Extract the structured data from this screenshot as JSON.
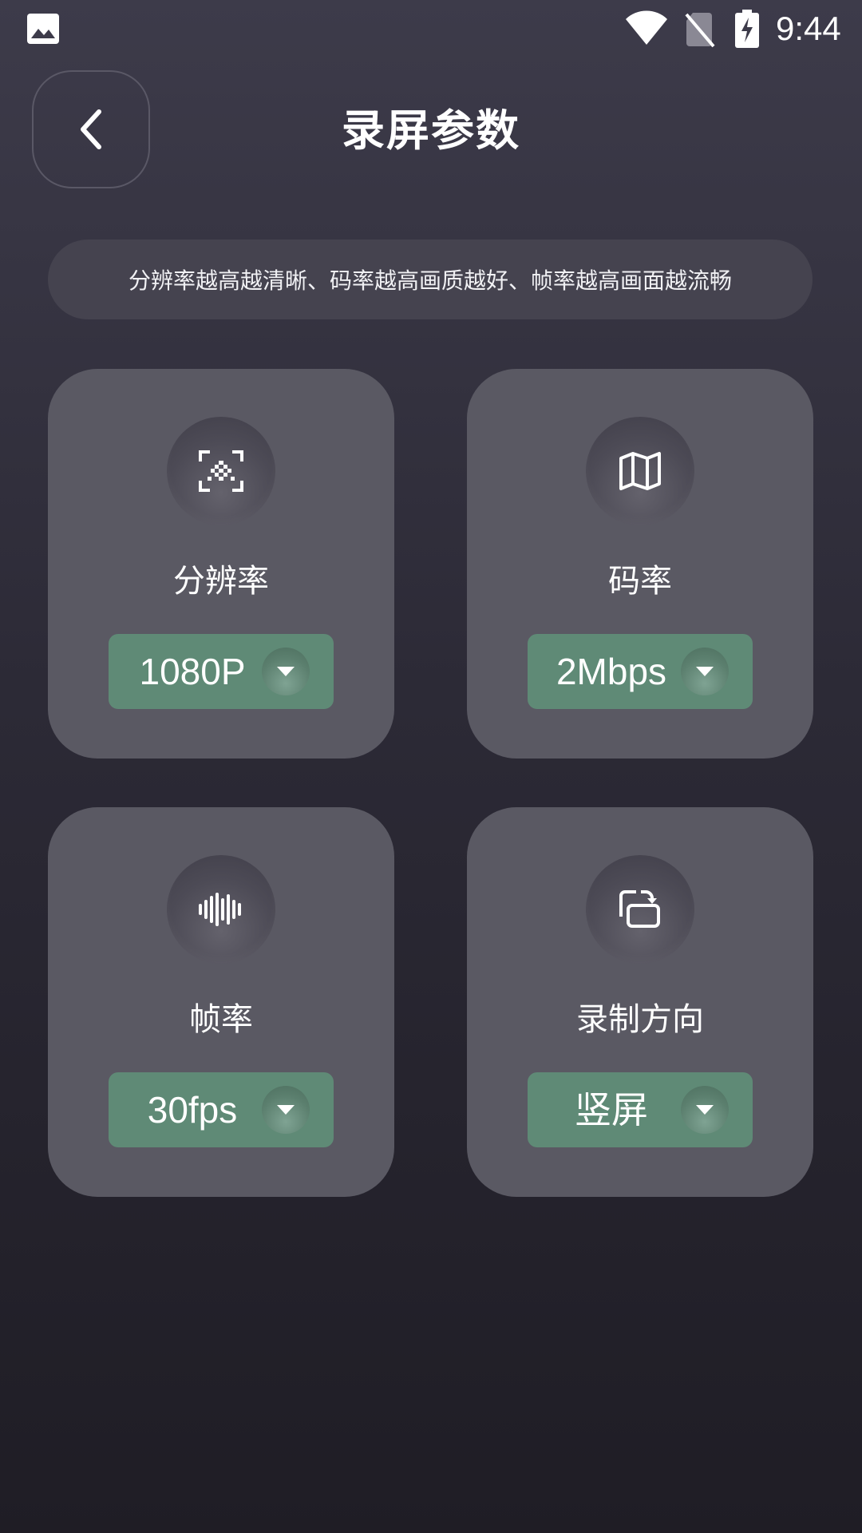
{
  "status_bar": {
    "time": "9:44",
    "icons": [
      "gallery-icon",
      "wifi-icon",
      "no-sim-icon",
      "battery-charging-icon"
    ]
  },
  "header": {
    "title": "录屏参数",
    "back_icon": "chevron-left-icon"
  },
  "hint": "分辨率越高越清晰、码率越高画质越好、帧率越高画面越流畅",
  "cards": [
    {
      "label": "分辨率",
      "value": "1080P",
      "icon": "scan-icon"
    },
    {
      "label": "码率",
      "value": "2Mbps",
      "icon": "map-icon"
    },
    {
      "label": "帧率",
      "value": "30fps",
      "icon": "waveform-icon"
    },
    {
      "label": "录制方向",
      "value": "竖屏",
      "icon": "rotate-screen-icon"
    }
  ],
  "colors": {
    "card_bg": "#5a5963",
    "select_bg": "#5f8a76",
    "hint_bg": "#45434f"
  }
}
